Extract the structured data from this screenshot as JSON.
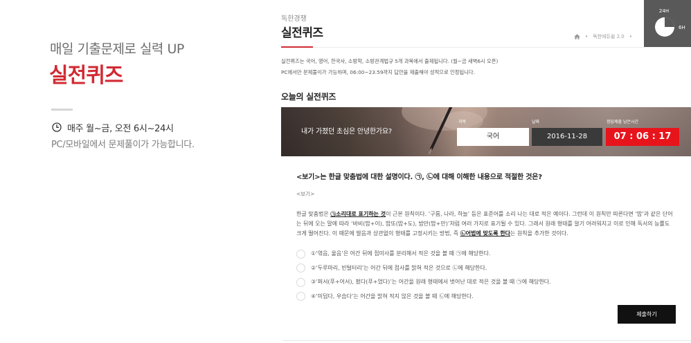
{
  "promo": {
    "tagline": "매일 기출문제로 실력 UP",
    "title": "실전퀴즈",
    "schedule_icon": "clock-icon",
    "schedule": "매주 월~금, 오전 6시~24시",
    "availability": "PC/모바일에서 문제풀이가 가능합니다."
  },
  "header": {
    "category": "독한경쟁",
    "title": "실전퀴즈",
    "breadcrumb": {
      "home_icon": "home-icon",
      "separator": "•",
      "items": [
        "독한에듀윌 2.0"
      ]
    }
  },
  "timer_widget": {
    "total_label": "24H",
    "elapsed_label": "6H",
    "elapsed_fraction": 0.25
  },
  "notices": [
    "실전퀴즈는 국어, 영어, 한국사, 소방학, 소방관계법규 5개 과목에서 출제됩니다. (월~금 새벽6시 오픈)",
    "PC에서만 문제풀이가 가능하며, 06:00~23:59까지 답안을 제출해야 성적으로 인정됩니다."
  ],
  "today": {
    "heading": "오늘의 실전퀴즈",
    "banner_message": "내가 가졌던 초심은 안녕한가요?",
    "subject": {
      "label": "과목",
      "value": "국어"
    },
    "date": {
      "label": "날짜",
      "value": "2016-11-28"
    },
    "remaining": {
      "label": "정답제출 남은시간",
      "value": "07 : 06 : 17"
    }
  },
  "question": {
    "prompt": "<보기>는 한글 맞춤법에 대한 설명이다. ㉠, ㉡에 대해 이해한 내용으로 적절한 것은?",
    "passage_label": "<보기>",
    "passage": [
      {
        "text": "한글 맞춤법은 ",
        "emphasis": false
      },
      {
        "text": "㉠소리대로 표기하는 것",
        "emphasis": true
      },
      {
        "text": "이 근본 원칙이다. ‘구름, 나라, 하늘’ 등은 표준어를 소리 나는 대로 적은 예이다. 그런데 이 원칙만 따른다면 ‘밥’과 같은 단어는 뒤에 오는 말에 따라 ‘바비(밥+이), 밥또(밥+도), 밤만(밥+만)’처럼 여러 가지로 표기될 수 있다. 그래서 원래 형태를 알기 어려워지고 이로 인해 독서의 능률도 크게 떨어진다. 이 때문에 발음과 상관없이 형태를 고정시키는 방법, 즉 ",
        "emphasis": false
      },
      {
        "text": "㉡어법에 맞도록 한다",
        "emphasis": true
      },
      {
        "text": "는 원칙을 추가한 것이다.",
        "emphasis": false
      }
    ],
    "options": [
      {
        "number": "①",
        "text": "‘엮음, 울음’은 어간 뒤에 접미사를 분리해서 적은 것을 볼 때 ㉠에 해당한다.",
        "checked": false
      },
      {
        "number": "②",
        "text": "‘두루마리, 빈털터리’는 어간 뒤에 접사를 밝혀 적은 것으로 ㉡에 해당한다.",
        "checked": false
      },
      {
        "number": "③",
        "text": "‘퍼서(푸+어서), 펐다(푸+었다)’는 어간을 원래 형태에서 벗어난 대로 적은 것을 볼 때 ㉠에 해당한다.",
        "checked": false
      },
      {
        "number": "④",
        "text": "‘미덥다, 우습다’는 어간을 밝혀 적지 않은 것을 볼 때 ㉡에 해당한다.",
        "checked": false
      }
    ]
  },
  "actions": {
    "submit_label": "제출하기"
  },
  "colors": {
    "accent": "#d12a33",
    "remaining_box": "#e8141c",
    "date_box": "#3a3a3a",
    "submit_button": "#111111",
    "timer_widget": "#595959"
  }
}
